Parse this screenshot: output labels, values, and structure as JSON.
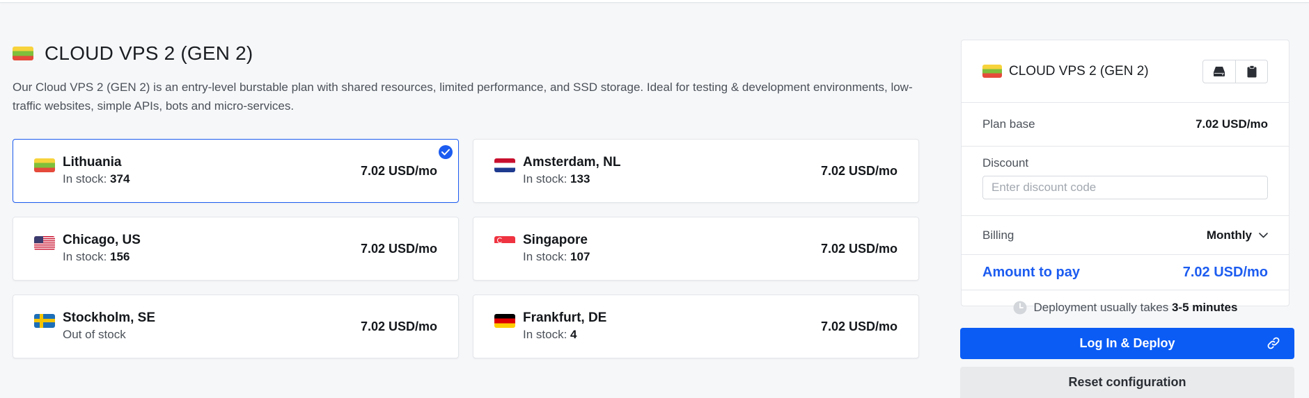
{
  "plan": {
    "title": "CLOUD VPS 2 (GEN 2)",
    "description": "Our Cloud VPS 2 (GEN 2) is an entry-level burstable plan with shared resources, limited performance, and SSD storage. Ideal for testing & development environments, low-traffic websites, simple APIs, bots and micro-services.",
    "flag": "lithuania-flag"
  },
  "locations": [
    {
      "name": "Lithuania",
      "stock_label": "In stock: ",
      "stock_count": "374",
      "price": "7.02 USD/mo",
      "flag": "lithuania-flag",
      "selected": true
    },
    {
      "name": "Amsterdam, NL",
      "stock_label": "In stock: ",
      "stock_count": "133",
      "price": "7.02 USD/mo",
      "flag": "netherlands-flag",
      "selected": false
    },
    {
      "name": "Chicago, US",
      "stock_label": "In stock: ",
      "stock_count": "156",
      "price": "7.02 USD/mo",
      "flag": "usa-flag",
      "selected": false
    },
    {
      "name": "Singapore",
      "stock_label": "In stock: ",
      "stock_count": "107",
      "price": "7.02 USD/mo",
      "flag": "singapore-flag",
      "selected": false
    },
    {
      "name": "Stockholm, SE",
      "stock_label": "Out of stock",
      "stock_count": "",
      "price": "7.02 USD/mo",
      "flag": "sweden-flag",
      "selected": false
    },
    {
      "name": "Frankfurt, DE",
      "stock_label": "In stock: ",
      "stock_count": "4",
      "price": "7.02 USD/mo",
      "flag": "germany-flag",
      "selected": false
    }
  ],
  "summary": {
    "title": "CLOUD VPS 2 (GEN 2)",
    "icons": [
      "drive-icon",
      "clipboard-icon"
    ],
    "plan_base_label": "Plan base",
    "plan_base_value": "7.02 USD/mo",
    "discount_label": "Discount",
    "discount_placeholder": "Enter discount code",
    "discount_value": "",
    "billing_label": "Billing",
    "billing_value": "Monthly",
    "amount_label": "Amount to pay",
    "amount_value": "7.02 USD/mo",
    "deploy_prefix": "Deployment usually takes ",
    "deploy_time": "3-5 minutes"
  },
  "actions": {
    "deploy_label": "Log In & Deploy",
    "reset_label": "Reset configuration"
  },
  "colors": {
    "accent": "#1c5cf0",
    "button": "#0b5cf5",
    "secondary_button": "#e9eaec"
  }
}
